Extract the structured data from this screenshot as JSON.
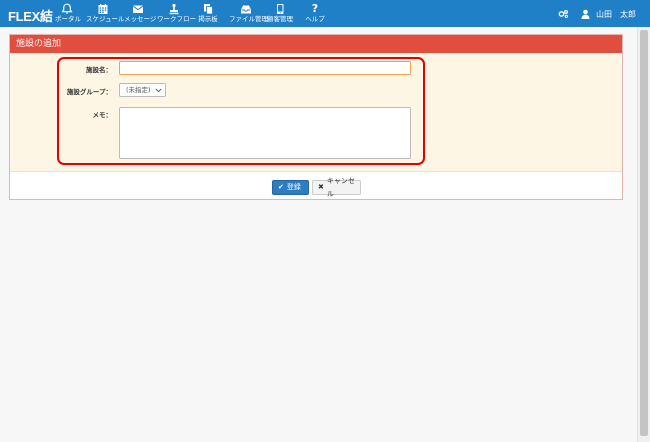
{
  "navbar": {
    "brand": "FLEX結",
    "items": [
      {
        "label": "ポータル",
        "icon": "bell-icon"
      },
      {
        "label": "スケジュール",
        "icon": "calendar-icon"
      },
      {
        "label": "メッセージ",
        "icon": "envelope-icon"
      },
      {
        "label": "ワークフロー",
        "icon": "stamp-icon"
      },
      {
        "label": "掲示板",
        "icon": "copy-icon"
      },
      {
        "label": "ファイル管理",
        "icon": "inbox-icon"
      },
      {
        "label": "顧客管理",
        "icon": "phone-icon"
      },
      {
        "label": "ヘルプ",
        "icon": "question-icon"
      }
    ],
    "user_name": "山田　太郎",
    "color": "#1f7fc7"
  },
  "panel": {
    "title": "施設の追加",
    "header_color": "#e14e3f"
  },
  "form": {
    "name_label": "施設名：",
    "name_value": "",
    "group_label": "施設グループ：",
    "group_selected": "(未指定)",
    "memo_label": "メモ：",
    "memo_value": ""
  },
  "buttons": {
    "save_label": "登録",
    "cancel_label": "キャンセル"
  }
}
